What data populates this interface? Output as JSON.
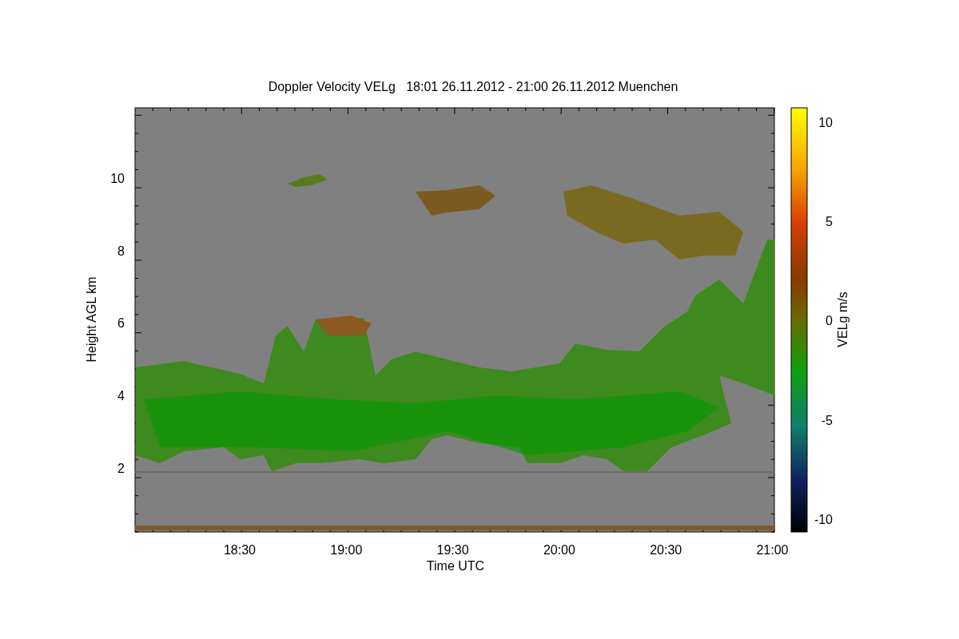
{
  "title": "Doppler Velocity VELg   18:01 26.11.2012 - 21:00 26.11.2012 Muenchen",
  "plot": {
    "xlabel": "Time UTC",
    "ylabel": "Height AGL km",
    "xtick_labels": [
      "18:30",
      "19:00",
      "19:30",
      "20:00",
      "20:30",
      "21:00"
    ],
    "ytick_labels": [
      "10",
      "8",
      "6",
      "4",
      "2"
    ]
  },
  "colorbar": {
    "label": "VELg m/s",
    "tick_labels": [
      "10",
      "5",
      "0",
      "-5",
      "-10"
    ]
  }
}
